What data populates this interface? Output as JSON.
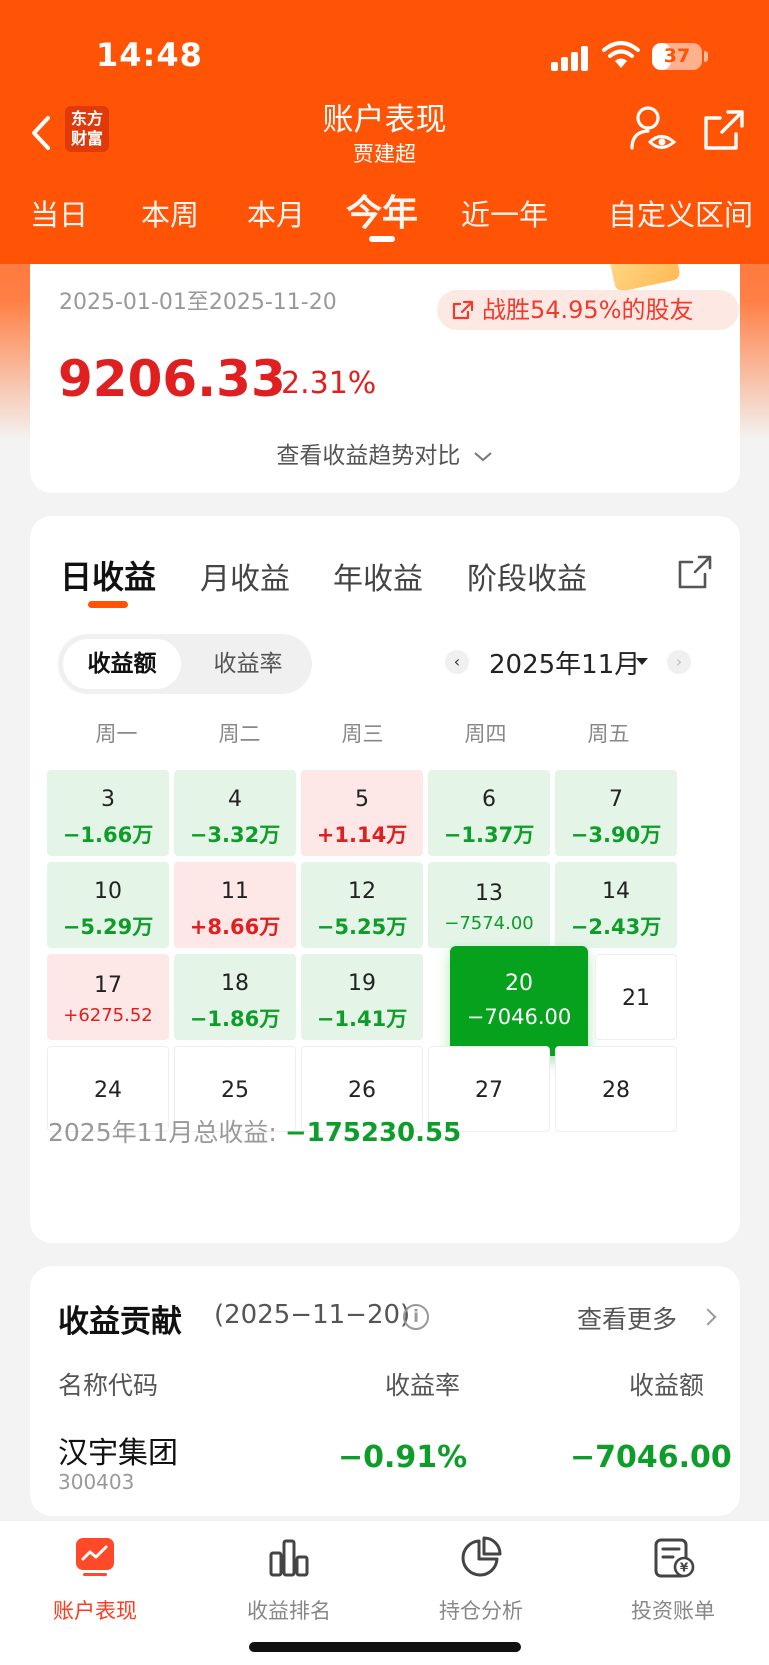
{
  "status_bar": {
    "time": "14:48",
    "battery": "37",
    "battery_level_percent": 37
  },
  "header": {
    "logo_text_line1": "东方",
    "logo_text_line2": "财富",
    "title": "账户表现",
    "subtitle": "贾建超"
  },
  "period_tabs": [
    "当日",
    "本周",
    "本月",
    "今年",
    "近一年",
    "自定义区间"
  ],
  "period_active": "今年",
  "summary": {
    "date_range": "2025-01-01至2025-11-20",
    "beat_text": "战胜54.95%的股友",
    "amount": "9206.33",
    "percent": "2.31%",
    "trend_link": "查看收益趋势对比"
  },
  "daily": {
    "tabs": [
      "日收益",
      "月收益",
      "年收益",
      "阶段收益"
    ],
    "toggle_on": "收益额",
    "toggle_off": "收益率",
    "month": "2025年11月",
    "weekdays": [
      "周一",
      "周二",
      "周三",
      "周四",
      "周五"
    ],
    "weeks": [
      [
        {
          "day": "3",
          "value": "−1.66万"
        },
        {
          "day": "4",
          "value": "−3.32万"
        },
        {
          "day": "5",
          "value": "+1.14万"
        },
        {
          "day": "6",
          "value": "−1.37万"
        },
        {
          "day": "7",
          "value": "−3.90万"
        }
      ],
      [
        {
          "day": "10",
          "value": "−5.29万"
        },
        {
          "day": "11",
          "value": "+8.66万"
        },
        {
          "day": "12",
          "value": "−5.25万"
        },
        {
          "day": "13",
          "value": "−7574.00"
        },
        {
          "day": "14",
          "value": "−2.43万"
        }
      ],
      [
        {
          "day": "17",
          "value": "+6275.52"
        },
        {
          "day": "18",
          "value": "−1.86万"
        },
        {
          "day": "19",
          "value": "−1.41万"
        },
        {
          "day": "20",
          "value": "−7046.00"
        },
        {
          "day": "21",
          "value": ""
        }
      ],
      [
        {
          "day": "24",
          "value": ""
        },
        {
          "day": "25",
          "value": ""
        },
        {
          "day": "26",
          "value": ""
        },
        {
          "day": "27",
          "value": ""
        },
        {
          "day": "28",
          "value": ""
        }
      ]
    ],
    "month_total_label": "2025年11月总收益: ",
    "month_total_value": "−175230.55"
  },
  "contribution": {
    "title": "收益贡献",
    "date": "(2025−11−20)",
    "see_more": "查看更多",
    "columns": [
      "名称代码",
      "收益率",
      "收益额"
    ],
    "rows": [
      {
        "name": "汉宇集团",
        "code": "300403",
        "rate": "−0.91%",
        "amount": "−7046.00"
      }
    ]
  },
  "tabbar": [
    "账户表现",
    "收益排名",
    "持仓分析",
    "投资账单"
  ],
  "colors": {
    "brand": "#ff5305",
    "gain": "#e02020",
    "loss": "#0e9d2a",
    "selected": "#06a21d"
  }
}
